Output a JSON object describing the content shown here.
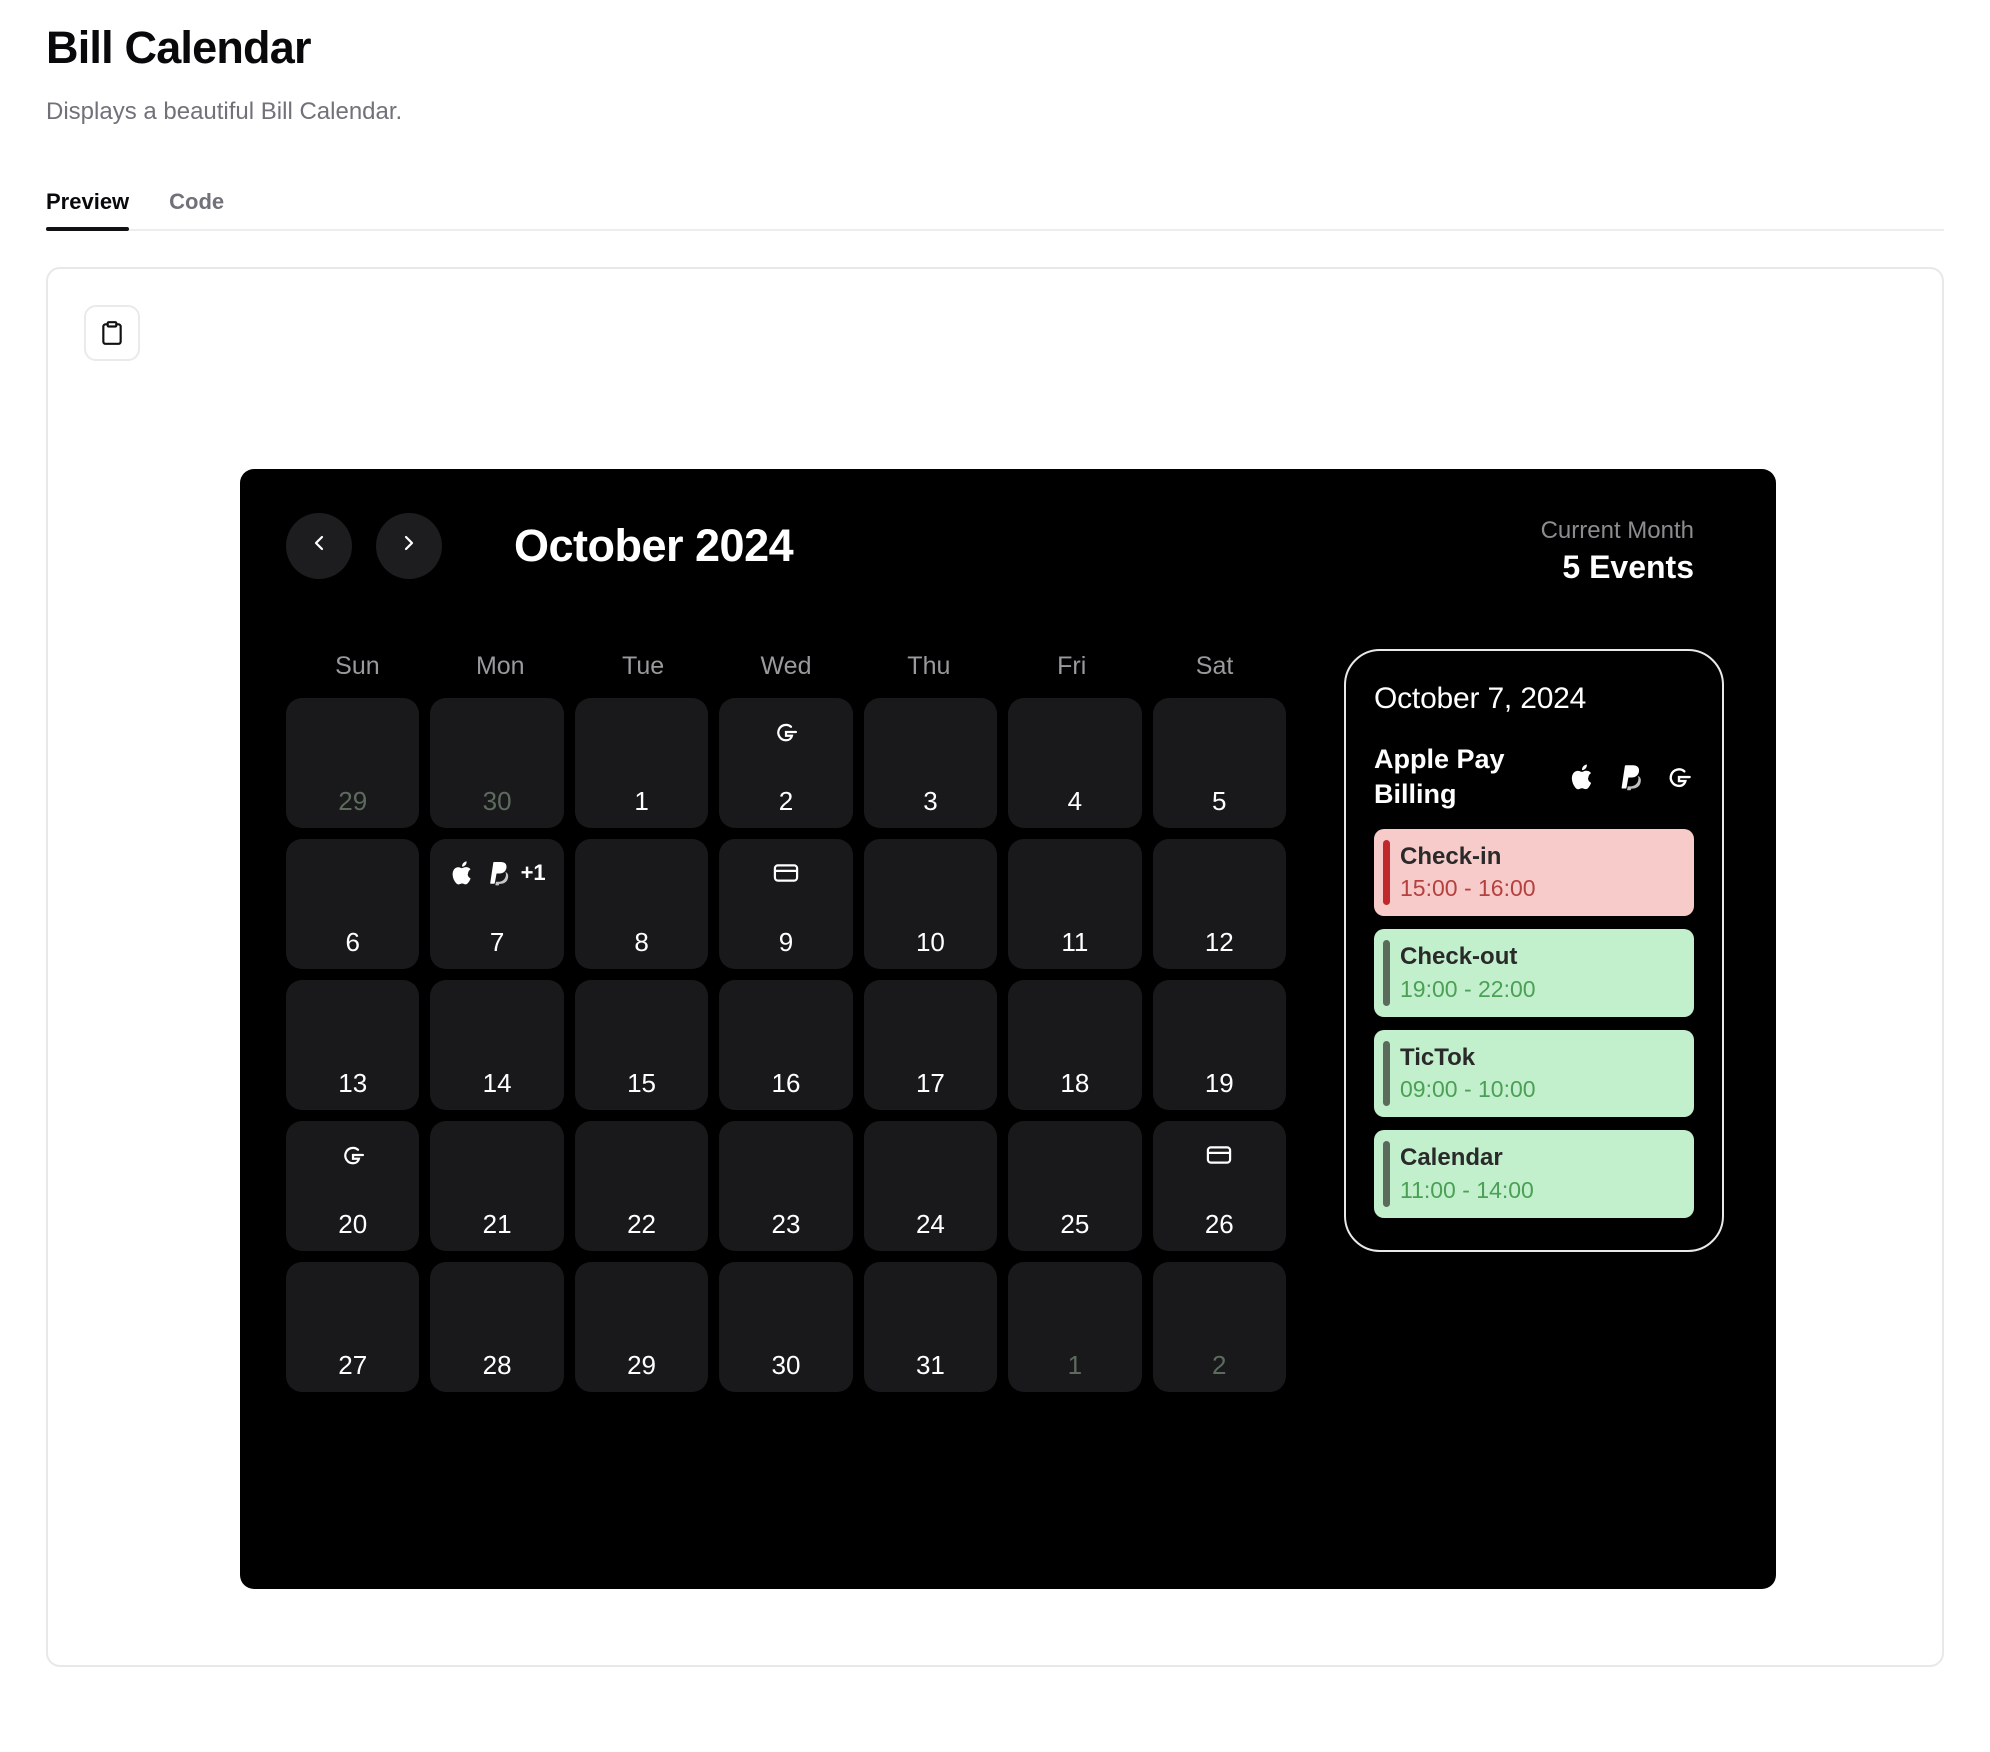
{
  "header": {
    "title": "Bill Calendar",
    "subtitle": "Displays a beautiful Bill Calendar.",
    "tabs": [
      {
        "label": "Preview",
        "active": true
      },
      {
        "label": "Code",
        "active": false
      }
    ]
  },
  "toolbar": {
    "copy_icon": "clipboard-icon"
  },
  "calendar": {
    "prev_icon": "chevron-left-icon",
    "next_icon": "chevron-right-icon",
    "month_title": "October 2024",
    "meta_label": "Current Month",
    "meta_value": "5 Events",
    "weekdays": [
      "Sun",
      "Mon",
      "Tue",
      "Wed",
      "Thu",
      "Fri",
      "Sat"
    ],
    "weeks": [
      [
        {
          "num": "29",
          "muted": true,
          "icons": []
        },
        {
          "num": "30",
          "muted": true,
          "icons": []
        },
        {
          "num": "1",
          "muted": false,
          "icons": []
        },
        {
          "num": "2",
          "muted": false,
          "icons": [
            "google-icon"
          ]
        },
        {
          "num": "3",
          "muted": false,
          "icons": []
        },
        {
          "num": "4",
          "muted": false,
          "icons": []
        },
        {
          "num": "5",
          "muted": false,
          "icons": []
        }
      ],
      [
        {
          "num": "6",
          "muted": false,
          "icons": []
        },
        {
          "num": "7",
          "muted": false,
          "icons": [
            "apple-icon",
            "paypal-icon"
          ],
          "overflow": "+1"
        },
        {
          "num": "8",
          "muted": false,
          "icons": []
        },
        {
          "num": "9",
          "muted": false,
          "icons": [
            "credit-card-icon"
          ]
        },
        {
          "num": "10",
          "muted": false,
          "icons": []
        },
        {
          "num": "11",
          "muted": false,
          "icons": []
        },
        {
          "num": "12",
          "muted": false,
          "icons": []
        }
      ],
      [
        {
          "num": "13",
          "muted": false,
          "icons": []
        },
        {
          "num": "14",
          "muted": false,
          "icons": []
        },
        {
          "num": "15",
          "muted": false,
          "icons": []
        },
        {
          "num": "16",
          "muted": false,
          "icons": []
        },
        {
          "num": "17",
          "muted": false,
          "icons": []
        },
        {
          "num": "18",
          "muted": false,
          "icons": []
        },
        {
          "num": "19",
          "muted": false,
          "icons": []
        }
      ],
      [
        {
          "num": "20",
          "muted": false,
          "icons": [
            "google-icon"
          ]
        },
        {
          "num": "21",
          "muted": false,
          "icons": []
        },
        {
          "num": "22",
          "muted": false,
          "icons": []
        },
        {
          "num": "23",
          "muted": false,
          "icons": []
        },
        {
          "num": "24",
          "muted": false,
          "icons": []
        },
        {
          "num": "25",
          "muted": false,
          "icons": []
        },
        {
          "num": "26",
          "muted": false,
          "icons": [
            "credit-card-icon"
          ]
        }
      ],
      [
        {
          "num": "27",
          "muted": false,
          "icons": []
        },
        {
          "num": "28",
          "muted": false,
          "icons": []
        },
        {
          "num": "29",
          "muted": false,
          "icons": []
        },
        {
          "num": "30",
          "muted": false,
          "icons": []
        },
        {
          "num": "31",
          "muted": false,
          "icons": []
        },
        {
          "num": "1",
          "muted": true,
          "icons": []
        },
        {
          "num": "2",
          "muted": true,
          "icons": []
        }
      ]
    ]
  },
  "detail": {
    "date": "October 7, 2024",
    "title": "Apple Pay Billing",
    "brand_icons": [
      "apple-icon",
      "paypal-icon",
      "google-icon"
    ],
    "events": [
      {
        "title": "Check-in",
        "time": "15:00 - 16:00",
        "tone": "red"
      },
      {
        "title": "Check-out",
        "time": "19:00 - 22:00",
        "tone": "green"
      },
      {
        "title": "TicTok",
        "time": "09:00 - 10:00",
        "tone": "green"
      },
      {
        "title": "Calendar",
        "time": "11:00 - 14:00",
        "tone": "green"
      }
    ]
  },
  "colors": {
    "card_bg": "#000000",
    "day_bg": "#19191b",
    "accent_red": "#c0282b",
    "event_red_bg": "#f8cbcb",
    "event_green_bg": "#c2f0cd",
    "muted_text": "#9a9a9e"
  }
}
